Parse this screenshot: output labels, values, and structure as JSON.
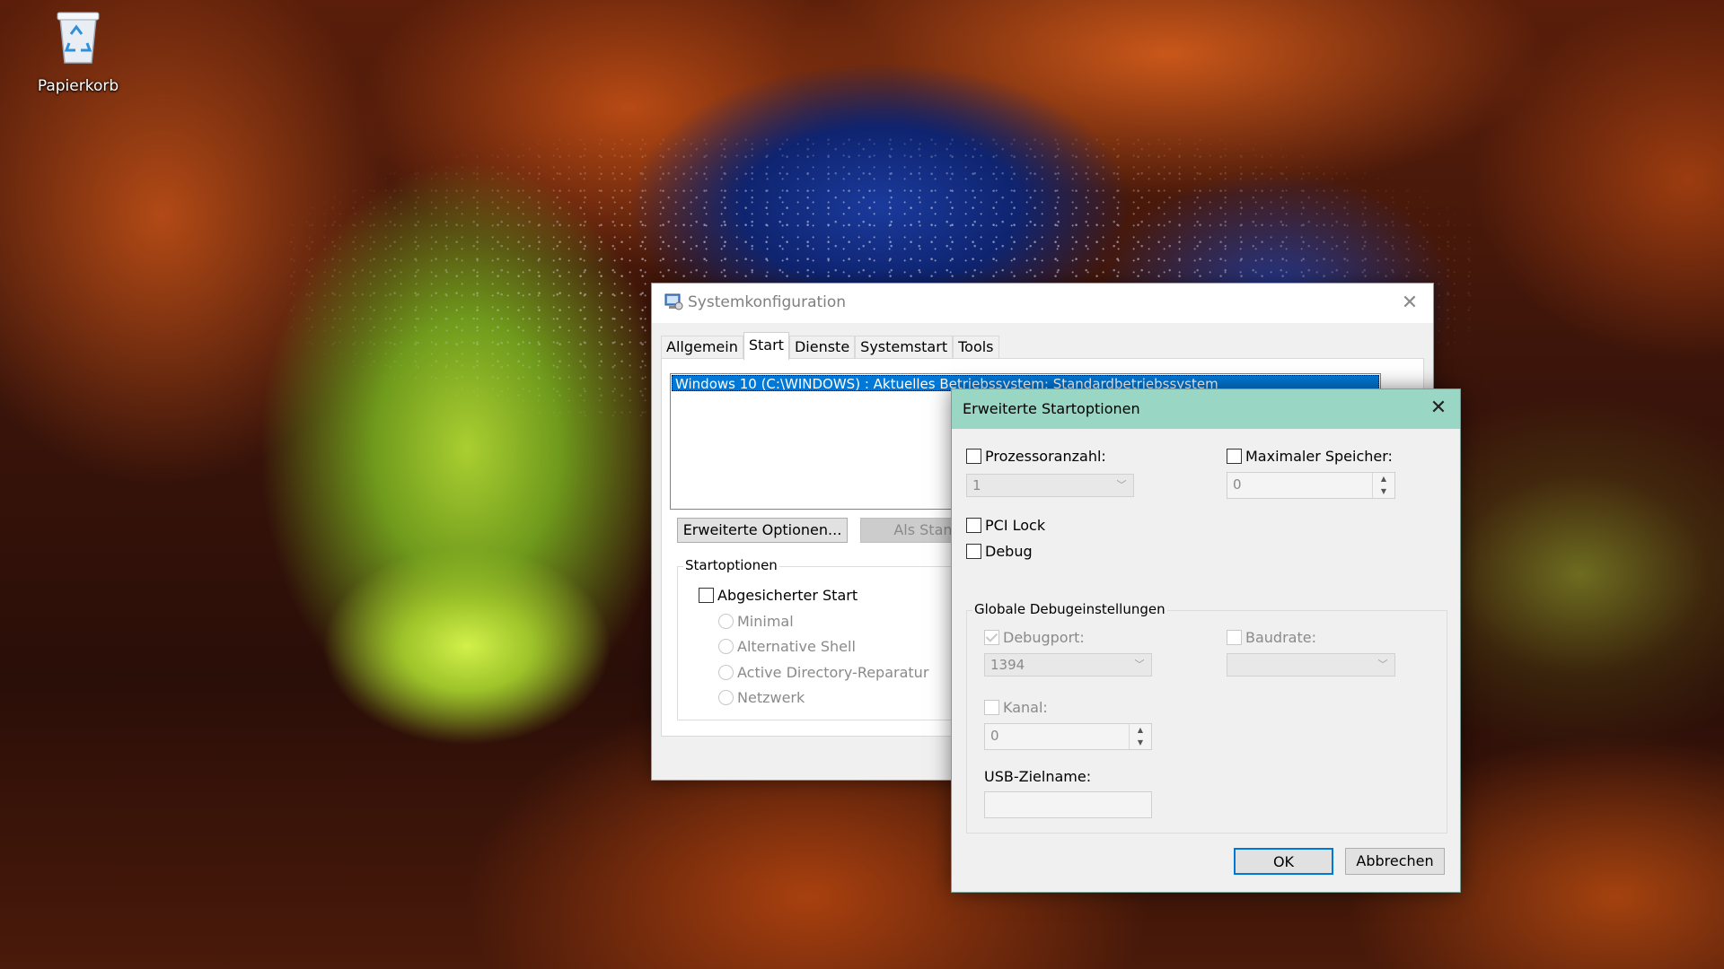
{
  "desktop": {
    "recycle_bin_label": "Papierkorb"
  },
  "sysconfig": {
    "title": "Systemkonfiguration",
    "tabs": [
      "Allgemein",
      "Start",
      "Dienste",
      "Systemstart",
      "Tools"
    ],
    "active_tab": "Start",
    "os_entry": "Windows 10 (C:\\WINDOWS) : Aktuelles Betriebssystem; Standardbetriebssystem",
    "advanced_button": "Erweiterte Optionen...",
    "set_default_button": "Als Stand",
    "boot_options_legend": "Startoptionen",
    "safe_boot_label": "Abgesicherter Start",
    "safe_boot_options": [
      "Minimal",
      "Alternative Shell",
      "Active Directory-Reparatur",
      "Netzwerk"
    ]
  },
  "dialog": {
    "title": "Erweiterte Startoptionen",
    "processor_label": "Prozessoranzahl:",
    "processor_value": "1",
    "max_memory_label": "Maximaler Speicher:",
    "max_memory_value": "0",
    "pci_lock_label": "PCI Lock",
    "debug_label": "Debug",
    "global_debug_legend": "Globale Debugeinstellungen",
    "debugport_label": "Debugport:",
    "debugport_value": "1394",
    "baudrate_label": "Baudrate:",
    "baudrate_value": "",
    "channel_label": "Kanal:",
    "channel_value": "0",
    "usb_target_label": "USB-Zielname:",
    "usb_target_value": "",
    "ok_label": "OK",
    "cancel_label": "Abbrechen"
  },
  "colors": {
    "selection": "#0078d7",
    "dialog_titlebar": "#99d6c4"
  }
}
